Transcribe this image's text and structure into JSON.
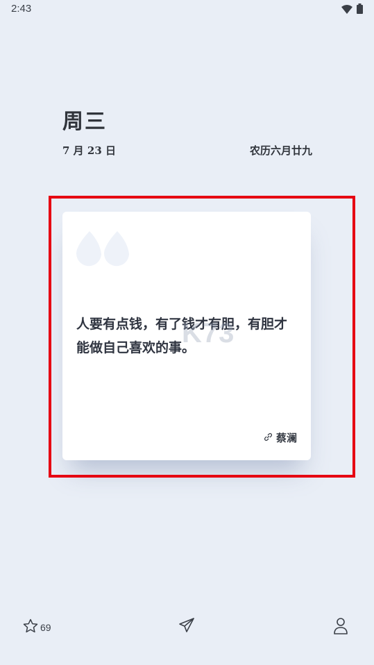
{
  "status_bar": {
    "time": "2:43",
    "icons": [
      "wifi-icon",
      "battery-icon"
    ]
  },
  "date_header": {
    "weekday": "周三",
    "date": "7 月 23 日",
    "lunar": "农历六月廿九"
  },
  "quote_card": {
    "text": "人要有点钱，有了钱才有胆，有胆才能做自己喜欢的事。",
    "author": "蔡澜",
    "icons": [
      "quote-mark-icon",
      "link-icon"
    ]
  },
  "watermark": {
    "text": "K73"
  },
  "bottom_nav": {
    "favorite_count": "69",
    "icons": [
      "star-icon",
      "send-icon",
      "user-icon"
    ]
  },
  "colors": {
    "background": "#e9eef6",
    "card": "#ffffff",
    "highlight_border": "#e60012",
    "text": "#2f3440"
  }
}
